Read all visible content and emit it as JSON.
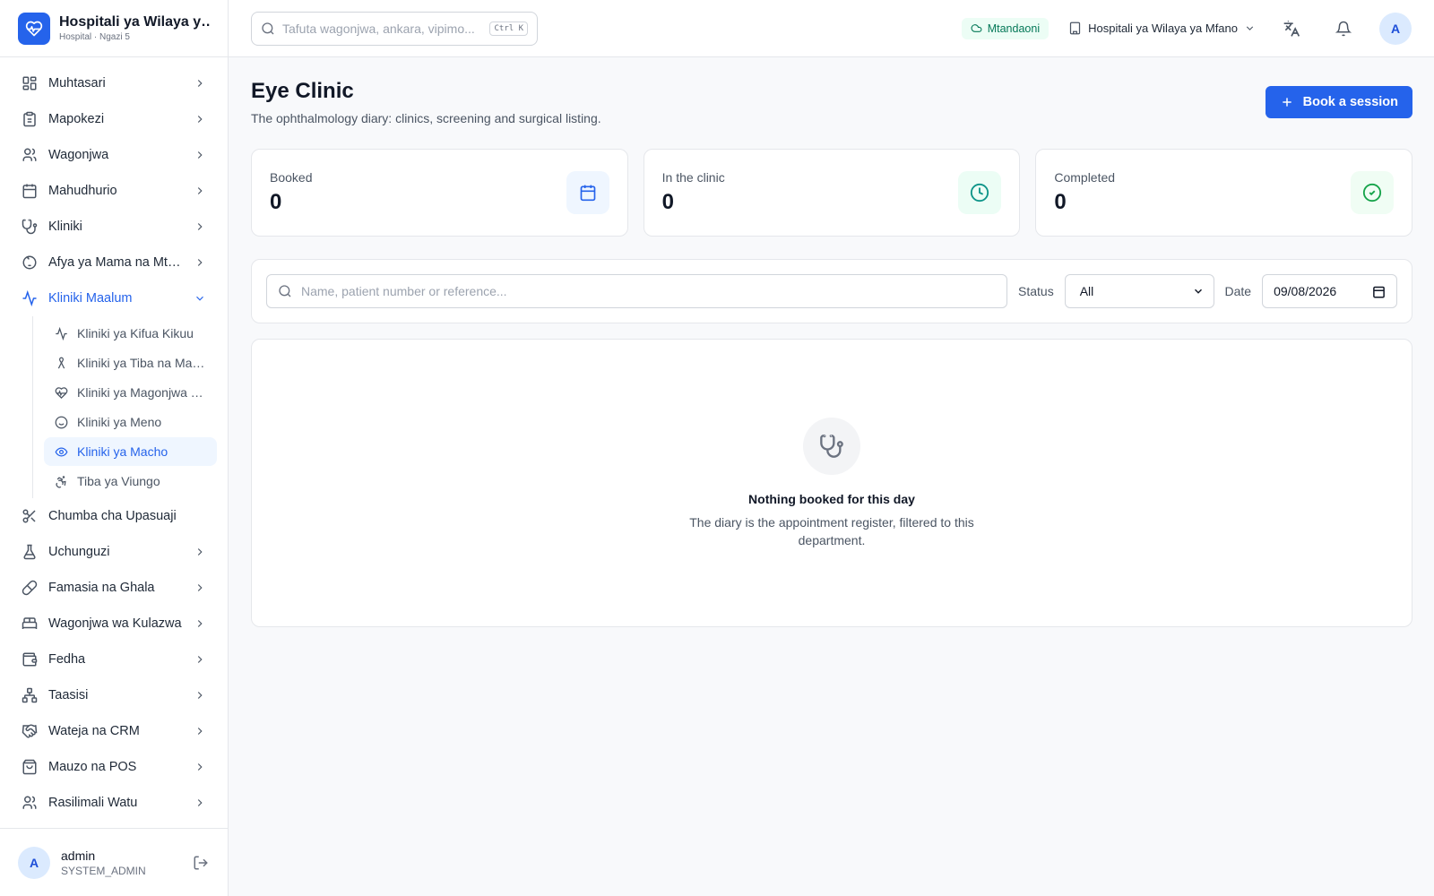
{
  "brand": {
    "title": "Hospitali ya Wilaya ya Mfano",
    "subtitle": "Hospital · Ngazi 5"
  },
  "topbar": {
    "search_placeholder": "Tafuta wagonjwa, ankara, vipimo...",
    "search_shortcut": "Ctrl K",
    "status": "Mtandaoni",
    "facility": "Hospitali ya Wilaya ya Mfano",
    "avatar_initial": "A"
  },
  "sidebar": {
    "items_top": [
      {
        "label": "Muhtasari",
        "icon": "dashboard-icon"
      },
      {
        "label": "Mapokezi",
        "icon": "clipboard-icon"
      },
      {
        "label": "Wagonjwa",
        "icon": "users-icon"
      },
      {
        "label": "Mahudhurio",
        "icon": "calendar-icon"
      },
      {
        "label": "Kliniki",
        "icon": "stethoscope-icon"
      },
      {
        "label": "Afya ya Mama na Mtoto",
        "icon": "baby-icon"
      }
    ],
    "open_group": {
      "label": "Kliniki Maalum",
      "icon": "activity-icon",
      "children": [
        {
          "label": "Kliniki ya Kifua Kikuu",
          "icon": "activity-icon"
        },
        {
          "label": "Kliniki ya Tiba na Matunzo",
          "icon": "ribbon-icon"
        },
        {
          "label": "Kliniki ya Magonjwa Yasiyoambukiza",
          "icon": "heart-pulse-icon"
        },
        {
          "label": "Kliniki ya Meno",
          "icon": "smile-icon"
        },
        {
          "label": "Kliniki ya Macho",
          "icon": "eye-icon",
          "active": true
        },
        {
          "label": "Tiba ya Viungo",
          "icon": "accessibility-icon"
        }
      ]
    },
    "items_bottom": [
      {
        "label": "Chumba cha Upasuaji",
        "icon": "scissors-icon",
        "chevron": false
      },
      {
        "label": "Uchunguzi",
        "icon": "flask-icon",
        "chevron": true
      },
      {
        "label": "Famasia na Ghala",
        "icon": "pill-icon",
        "chevron": true
      },
      {
        "label": "Wagonjwa wa Kulazwa",
        "icon": "bed-icon",
        "chevron": true
      },
      {
        "label": "Fedha",
        "icon": "wallet-icon",
        "chevron": true
      },
      {
        "label": "Taasisi",
        "icon": "network-icon",
        "chevron": true
      },
      {
        "label": "Wateja na CRM",
        "icon": "handshake-icon",
        "chevron": true
      },
      {
        "label": "Mauzo na POS",
        "icon": "shopping-bag-icon",
        "chevron": true
      },
      {
        "label": "Rasilimali Watu",
        "icon": "users-icon",
        "chevron": true
      }
    ],
    "user": {
      "initial": "A",
      "name": "admin",
      "role": "SYSTEM_ADMIN"
    }
  },
  "page": {
    "title": "Eye Clinic",
    "subtitle": "The ophthalmology diary: clinics, screening and surgical listing.",
    "book_button": "Book a session"
  },
  "stats": [
    {
      "label": "Booked",
      "value": "0",
      "icon": "calendar-icon",
      "color": "#2563eb",
      "bg": "#eff6ff"
    },
    {
      "label": "In the clinic",
      "value": "0",
      "icon": "clock-icon",
      "color": "#0d9488",
      "bg": "#ecfdf5"
    },
    {
      "label": "Completed",
      "value": "0",
      "icon": "check-circle-icon",
      "color": "#16a34a",
      "bg": "#f0fdf4"
    }
  ],
  "filters": {
    "search_placeholder": "Name, patient number or reference...",
    "status_label": "Status",
    "status_value": "All",
    "date_label": "Date",
    "date_value": "09/08/2026"
  },
  "empty": {
    "title": "Nothing booked for this day",
    "description": "The diary is the appointment register, filtered to this department."
  }
}
